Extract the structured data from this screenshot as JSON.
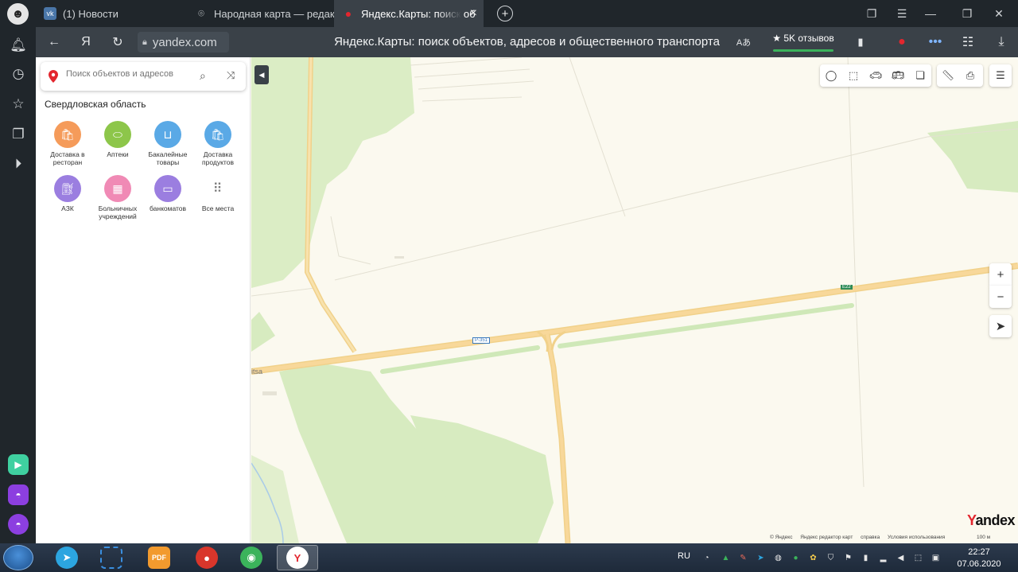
{
  "browser": {
    "tabs": [
      {
        "label": "(1) Новости",
        "icon": "vk-icon"
      },
      {
        "label": "Народная карта — редакт",
        "icon": "map-pin-outline-icon"
      },
      {
        "label": "Яндекс.Карты: поиск об",
        "icon": "map-pin-red-icon"
      }
    ],
    "yandex_button": "Я",
    "url": "yandex.com",
    "page_title": "Яндекс.Карты: поиск объектов, адресов и общественного транспорта",
    "reviews": "★ 5K отзывов"
  },
  "panel": {
    "search_placeholder": "Поиск объектов и адресов",
    "region": "Свердловская область",
    "categories": [
      {
        "label": "Доставка в ресторан",
        "color": "#f59b5a",
        "icon": "bag-icon"
      },
      {
        "label": "Аптеки",
        "color": "#8dc64a",
        "icon": "pill-icon"
      },
      {
        "label": "Бакалейные товары",
        "color": "#5aa9e6",
        "icon": "basket-icon"
      },
      {
        "label": "Доставка продуктов",
        "color": "#5aa9e6",
        "icon": "bag-icon"
      },
      {
        "label": "АЗК",
        "color": "#9b7ee0",
        "icon": "fuel-icon"
      },
      {
        "label": "Больничных учреждений",
        "color": "#f08ab5",
        "icon": "hospital-icon"
      },
      {
        "label": "банкоматов",
        "color": "#9b7ee0",
        "icon": "atm-icon"
      },
      {
        "label": "Все места",
        "color": "#ffffff",
        "icon": "dots-grid-icon"
      }
    ]
  },
  "map": {
    "road_labels": {
      "r351": "Р-351",
      "e22": "E22",
      "place": "itsa"
    },
    "logo_first": "Y",
    "logo_rest": "andex",
    "copyright": [
      "© Яндекс",
      "Яндекс редактор карт",
      "справка",
      "Условия использования"
    ],
    "scale": "100 м",
    "zoom_in": "+",
    "zoom_out": "−"
  },
  "taskbar": {
    "lang": "RU",
    "time": "22:27",
    "date": "07.06.2020",
    "pdf_label": "PDF"
  },
  "colors": {
    "green_area": "#d7ebc0",
    "road": "#f8d89a",
    "land": "#fbf9ef",
    "brand_red": "#e3262e"
  }
}
